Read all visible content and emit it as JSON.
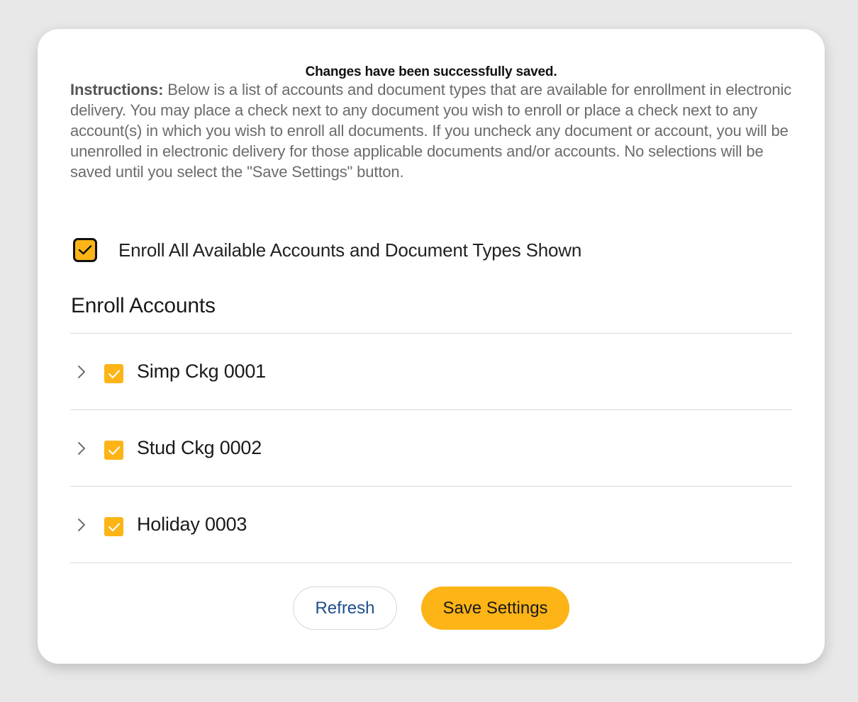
{
  "message": {
    "success": "Changes have been successfully saved."
  },
  "instructions": {
    "label": "Instructions:",
    "text": " Below is a list of accounts and document types that are available for enrollment in electronic delivery. You may place a check next to any document you wish to enroll or place a check next to any account(s) in which you wish to enroll all documents. If you uncheck any document or account, you will be unenrolled in electronic delivery for those applicable documents and/or accounts. No selections will be saved until you select the \"Save Settings\" button."
  },
  "enroll_all": {
    "label": "Enroll All Available Accounts and Document Types Shown",
    "checked": true
  },
  "section": {
    "title": "Enroll Accounts"
  },
  "accounts": [
    {
      "label": "Simp Ckg 0001",
      "checked": true
    },
    {
      "label": "Stud Ckg 0002",
      "checked": true
    },
    {
      "label": "Holiday 0003",
      "checked": true
    }
  ],
  "buttons": {
    "refresh": "Refresh",
    "save": "Save Settings"
  },
  "colors": {
    "accent": "#fcb416",
    "link": "#1f4e8c",
    "background": "#e8e8e8"
  }
}
